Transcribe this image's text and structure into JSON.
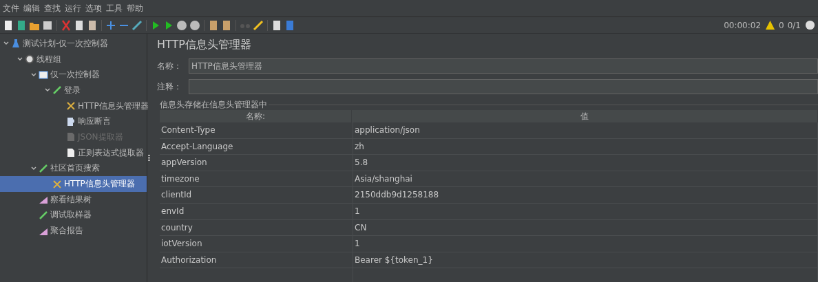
{
  "menu": [
    "文件",
    "编辑",
    "查找",
    "运行",
    "选项",
    "工具",
    "帮助"
  ],
  "status": {
    "timer": "00:00:02",
    "warnings": "0",
    "threads": "0/1"
  },
  "tree": [
    {
      "label": "测试计划-仅一次控制器",
      "kind": "plan",
      "expanded": true,
      "selected": false,
      "disabled": false,
      "children": [
        {
          "label": "线程组",
          "kind": "threads",
          "expanded": true,
          "selected": false,
          "disabled": false,
          "children": [
            {
              "label": "仅一次控制器",
              "kind": "controller",
              "expanded": true,
              "selected": false,
              "disabled": false,
              "children": [
                {
                  "label": "登录",
                  "kind": "sampler",
                  "expanded": true,
                  "selected": false,
                  "disabled": false,
                  "children": [
                    {
                      "label": "HTTP信息头管理器",
                      "kind": "config",
                      "selected": false,
                      "disabled": false
                    },
                    {
                      "label": "响应断言",
                      "kind": "assertion",
                      "selected": false,
                      "disabled": false
                    },
                    {
                      "label": "JSON提取器",
                      "kind": "extractor",
                      "selected": false,
                      "disabled": true
                    },
                    {
                      "label": "正则表达式提取器",
                      "kind": "extractor",
                      "selected": false,
                      "disabled": false
                    }
                  ]
                }
              ]
            },
            {
              "label": "社区首页搜索",
              "kind": "sampler",
              "expanded": true,
              "selected": false,
              "disabled": false,
              "children": [
                {
                  "label": "HTTP信息头管理器",
                  "kind": "config",
                  "selected": true,
                  "disabled": false
                }
              ]
            },
            {
              "label": "察看结果树",
              "kind": "listener",
              "selected": false,
              "disabled": false
            },
            {
              "label": "调试取样器",
              "kind": "sampler",
              "selected": false,
              "disabled": false
            },
            {
              "label": "聚合报告",
              "kind": "listener",
              "selected": false,
              "disabled": false
            }
          ]
        }
      ]
    }
  ],
  "panel": {
    "title": "HTTP信息头管理器",
    "name_label": "名称：",
    "name_value": "HTTP信息头管理器",
    "comment_label": "注释：",
    "group_title": "信息头存储在信息头管理器中"
  },
  "table": {
    "columns": [
      "名称:",
      "值"
    ],
    "rows": [
      [
        "Content-Type",
        "application/json"
      ],
      [
        "Accept-Language",
        "zh"
      ],
      [
        "appVersion",
        "5.8"
      ],
      [
        "timezone",
        "Asia/shanghai"
      ],
      [
        "clientId",
        "2150ddb9d1258188"
      ],
      [
        "envId",
        "1"
      ],
      [
        "country",
        "CN"
      ],
      [
        "iotVersion",
        "1"
      ],
      [
        "Authorization",
        "Bearer ${token_1}"
      ]
    ]
  }
}
